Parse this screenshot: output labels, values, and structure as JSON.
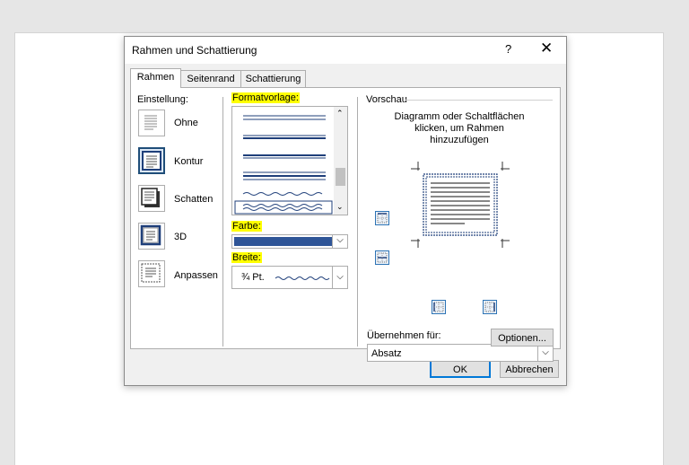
{
  "dialog": {
    "title": "Rahmen und Schattierung",
    "help": "?",
    "close": "✕"
  },
  "tabs": [
    "Rahmen",
    "Seitenrand",
    "Schattierung"
  ],
  "einstellung": {
    "label": "Einstellung:",
    "items": [
      "Ohne",
      "Kontur",
      "Schatten",
      "3D",
      "Anpassen"
    ]
  },
  "formatvorlage": {
    "label": "Formatvorlage:"
  },
  "farbe": {
    "label": "Farbe:",
    "value_color": "#2f5597"
  },
  "breite": {
    "label": "Breite:",
    "value": "¾ Pt."
  },
  "vorschau": {
    "label": "Vorschau",
    "hint_line1": "Diagramm oder Schaltflächen",
    "hint_line2": "klicken, um Rahmen",
    "hint_line3": "hinzuzufügen"
  },
  "uebernehmen": {
    "label": "Übernehmen für:",
    "value": "Absatz"
  },
  "buttons": {
    "optionen": "Optionen...",
    "ok": "OK",
    "abbrechen": "Abbrechen"
  },
  "colors": {
    "accent": "#0078d7",
    "highlight": "#ffff00",
    "border_blue": "#1f3f7a"
  }
}
